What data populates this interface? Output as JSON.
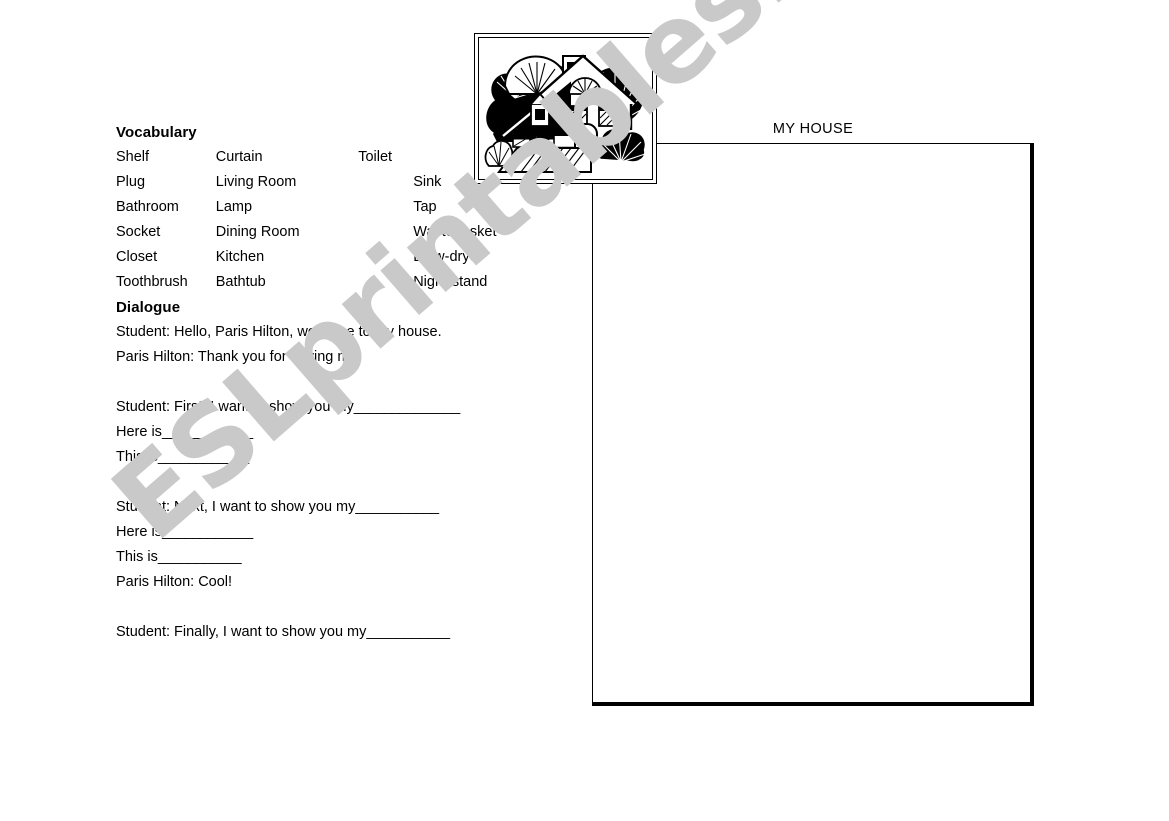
{
  "worksheet": {
    "vocabulary": {
      "heading": "Vocabulary",
      "rows": [
        {
          "col1": "Shelf",
          "col2": "Curtain",
          "col3": "Toilet"
        },
        {
          "col1": "Plug",
          "col2": "Living Room",
          "col3": "Sink"
        },
        {
          "col1": "Bathroom",
          "col2": "Lamp",
          "col3": "Tap"
        },
        {
          "col1": "Socket",
          "col2": "Dining Room",
          "col3": "Wastebasket"
        },
        {
          "col1": "Closet",
          "col2": "Kitchen",
          "col3": "Blow-dryer"
        },
        {
          "col1": "Toothbrush",
          "col2": "Bathtub",
          "col3": "Night-stand"
        }
      ]
    },
    "dialogue": {
      "heading": "Dialogue",
      "lines": [
        {
          "text": "Student: Hello, Paris Hilton, welcome to my house.",
          "blank": ""
        },
        {
          "text": "Paris Hilton: Thank you for having me.",
          "blank": ""
        },
        {
          "text": "",
          "blank": ""
        },
        {
          "text": "Student: First, I want to show you my",
          "blank": "______________"
        },
        {
          "text": "Here is",
          "blank": "____________"
        },
        {
          "text": "This is",
          "blank": "____________"
        },
        {
          "text": "",
          "blank": ""
        },
        {
          "text": "Student: Next, I want to show you my",
          "blank": "___________"
        },
        {
          "text": "Here is",
          "blank": "____________"
        },
        {
          "text": "This is",
          "blank": "___________"
        },
        {
          "text": "Paris Hilton: Cool!",
          "blank": ""
        },
        {
          "text": "",
          "blank": ""
        },
        {
          "text": "Student: Finally, I want to show you my",
          "blank": "___________"
        }
      ]
    }
  },
  "house_panel": {
    "title": "MY HOUSE"
  },
  "illustration": {
    "alt": "house-clipart"
  },
  "watermark": {
    "text": "ESLprintables.com",
    "color": "#c9c9c9"
  }
}
